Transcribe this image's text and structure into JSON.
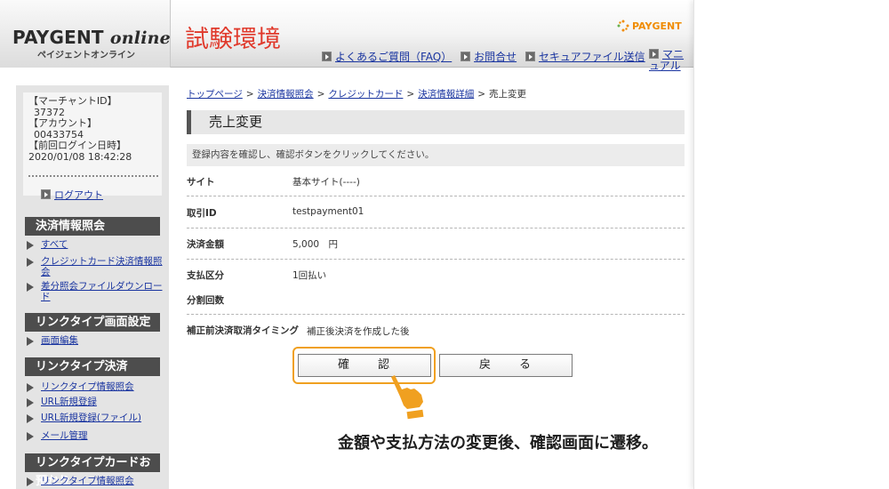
{
  "header": {
    "logo_main": "PAYGENT",
    "logo_online": "online",
    "logo_sub": "ペイジェントオンライン",
    "env_title": "試験環境",
    "brand": "PAYGENT",
    "links": [
      {
        "label": "よくあるご質問（FAQ）"
      },
      {
        "label": "お問合せ"
      },
      {
        "label": "セキュアファイル送信"
      },
      {
        "label": "マニュアル"
      }
    ]
  },
  "account": {
    "merchant_label": "【マーチャントID】",
    "merchant_id": "37372",
    "account_label": "【アカウント】",
    "account_id": "00433754",
    "last_login_label": "【前回ログイン日時】",
    "last_login": "2020/01/08 18:42:28",
    "logout": "ログアウト"
  },
  "sidebar": {
    "sections": [
      {
        "title": "決済情報照会"
      },
      {
        "title": "リンクタイプ画面設定"
      },
      {
        "title": "リンクタイプ決済"
      },
      {
        "title": "リンクタイプカードお預かり"
      }
    ],
    "items": [
      {
        "label": "すべて"
      },
      {
        "label": "クレジットカード決済情報照会"
      },
      {
        "label": "差分照会ファイルダウンロード"
      },
      {
        "label": "画面編集"
      },
      {
        "label": "リンクタイプ情報照会"
      },
      {
        "label": "URL新規登録"
      },
      {
        "label": "URL新規登録(ファイル)"
      },
      {
        "label": "メール管理"
      },
      {
        "label": "リンクタイプ情報照会"
      }
    ]
  },
  "breadcrumb": {
    "items": [
      "トップページ",
      "決済情報照会",
      "クレジットカード",
      "決済情報詳細"
    ],
    "separator": ">",
    "current": "売上変更"
  },
  "main": {
    "title": "売上変更",
    "notice": "登録内容を確認し、確認ボタンをクリックしてください。",
    "rows": [
      {
        "label": "サイト",
        "value": "基本サイト(----)"
      },
      {
        "label": "取引ID",
        "value": "testpayment01"
      },
      {
        "label": "決済金額",
        "value": "5,000　円"
      },
      {
        "label": "支払区分",
        "value": "1回払い"
      },
      {
        "label": "分割回数",
        "value": ""
      },
      {
        "label": "補正前決済取消タイミング",
        "value": "補正後決済を作成した後"
      }
    ],
    "confirm_button": "確　　認",
    "back_button": "戻　　る"
  },
  "annotation": {
    "caption": "金額や支払方法の変更後、確認画面に遷移。",
    "highlight_color": "#f0a020",
    "hand_icon": "pointing-hand-icon"
  },
  "colors": {
    "env_title": "#e0392b",
    "link": "#1a35a0",
    "section_header": "#4d4d4d",
    "brand": "#f08c00"
  }
}
